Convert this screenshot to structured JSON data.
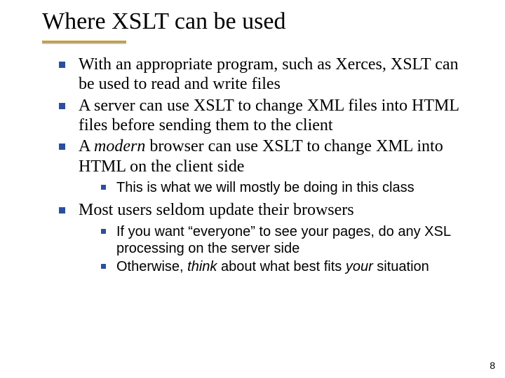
{
  "title": "Where XSLT can be used",
  "bullets": {
    "b1": "With an appropriate program, such as Xerces, XSLT can be used to read and write files",
    "b2": "A server can use XSLT to change XML files into HTML files before sending them to the client",
    "b3_pre": "A ",
    "b3_em": "modern",
    "b3_post": " browser can use XSLT to change XML into HTML on the client side",
    "b3_sub1": "This is what we will mostly be doing in this class",
    "b4": "Most users seldom update their browsers",
    "b4_sub1": "If you want “everyone” to see your pages, do any XSL processing on the server side",
    "b4_sub2_pre": "Otherwise, ",
    "b4_sub2_em1": "think",
    "b4_sub2_mid": " about what best fits ",
    "b4_sub2_em2": "your",
    "b4_sub2_post": " situation"
  },
  "page_number": "8"
}
